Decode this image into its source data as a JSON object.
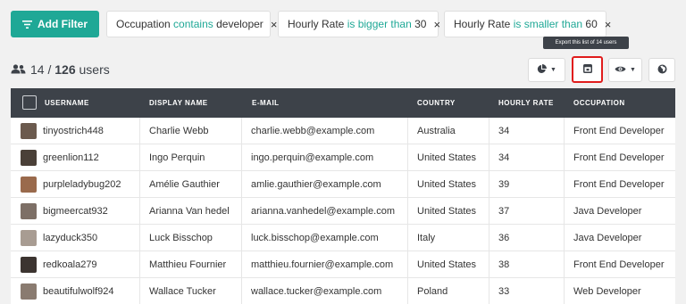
{
  "toolbar": {
    "add_filter_label": "Add Filter",
    "filters": [
      {
        "field": "Occupation",
        "operator": "contains",
        "value": "developer"
      },
      {
        "field": "Hourly Rate",
        "operator": "is bigger than",
        "value": "30"
      },
      {
        "field": "Hourly Rate",
        "operator": "is smaller than",
        "value": "60"
      }
    ],
    "remove_symbol": "×"
  },
  "tooltip": {
    "text": "Export this list of 14 users"
  },
  "summary": {
    "shown": "14",
    "slash": "/",
    "total": "126",
    "noun": "users"
  },
  "table": {
    "headers": {
      "username": "USERNAME",
      "display_name": "DISPLAY NAME",
      "email": "E-MAIL",
      "country": "COUNTRY",
      "hourly_rate": "HOURLY RATE",
      "occupation": "OCCUPATION"
    },
    "rows": [
      {
        "username": "tinyostrich448",
        "display_name": "Charlie Webb",
        "email": "charlie.webb@example.com",
        "country": "Australia",
        "hourly_rate": "34",
        "occupation": "Front End Developer",
        "avatar_color": "#6b5a4e"
      },
      {
        "username": "greenlion112",
        "display_name": "Ingo Perquin",
        "email": "ingo.perquin@example.com",
        "country": "United States",
        "hourly_rate": "34",
        "occupation": "Front End Developer",
        "avatar_color": "#4a4038"
      },
      {
        "username": "purpleladybug202",
        "display_name": "Amélie Gauthier",
        "email": "amlie.gauthier@example.com",
        "country": "United States",
        "hourly_rate": "39",
        "occupation": "Front End Developer",
        "avatar_color": "#9a6a4c"
      },
      {
        "username": "bigmeercat932",
        "display_name": "Arianna Van hedel",
        "email": "arianna.vanhedel@example.com",
        "country": "United States",
        "hourly_rate": "37",
        "occupation": "Java Developer",
        "avatar_color": "#7d6f66"
      },
      {
        "username": "lazyduck350",
        "display_name": "Luck Bisschop",
        "email": "luck.bisschop@example.com",
        "country": "Italy",
        "hourly_rate": "36",
        "occupation": "Java Developer",
        "avatar_color": "#a89c92"
      },
      {
        "username": "redkoala279",
        "display_name": "Matthieu Fournier",
        "email": "matthieu.fournier@example.com",
        "country": "United States",
        "hourly_rate": "38",
        "occupation": "Front End Developer",
        "avatar_color": "#3c3430"
      },
      {
        "username": "beautifulwolf924",
        "display_name": "Wallace Tucker",
        "email": "wallace.tucker@example.com",
        "country": "Poland",
        "hourly_rate": "33",
        "occupation": "Web Developer",
        "avatar_color": "#8a7b70"
      }
    ]
  },
  "colors": {
    "accent": "#1fa896",
    "header_bg": "#3d4249",
    "highlight": "#e01c1c"
  }
}
